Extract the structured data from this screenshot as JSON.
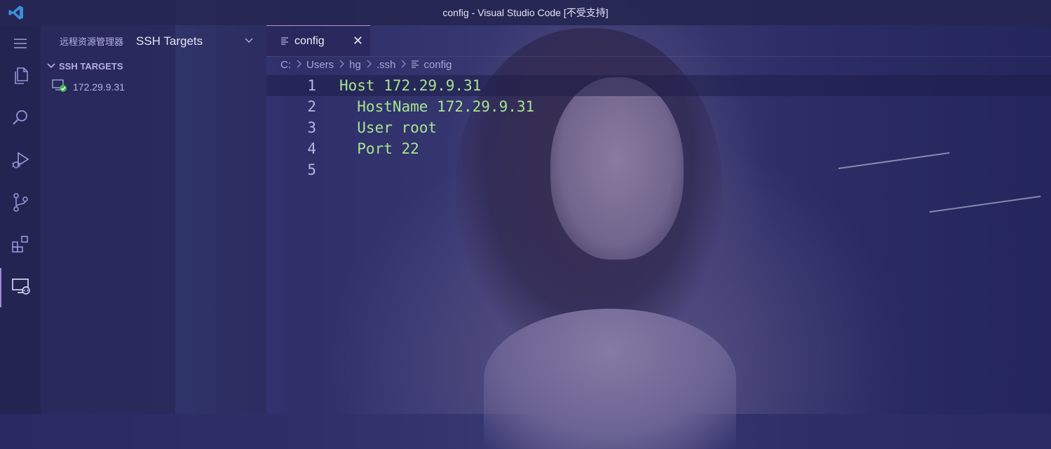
{
  "window": {
    "title": "config - Visual Studio Code [不受支持]"
  },
  "activity_bar": {
    "items": [
      {
        "icon": "menu-icon"
      },
      {
        "icon": "explorer-icon"
      },
      {
        "icon": "search-icon"
      },
      {
        "icon": "run-debug-icon"
      },
      {
        "icon": "source-control-icon"
      },
      {
        "icon": "extensions-icon"
      },
      {
        "icon": "remote-explorer-icon",
        "active": true
      }
    ]
  },
  "sidebar": {
    "view_title": "远程资源管理器",
    "targets_select": {
      "value": "SSH Targets"
    },
    "section_title": "SSH TARGETS",
    "hosts": [
      {
        "label": "172.29.9.31",
        "status": "connected"
      }
    ]
  },
  "editor": {
    "tab": {
      "label": "config",
      "close": "✕"
    },
    "breadcrumb": [
      "C:",
      "Users",
      "hg",
      ".ssh",
      "config"
    ],
    "lines": [
      {
        "number": "1",
        "text": "Host 172.29.9.31"
      },
      {
        "number": "2",
        "text": "  HostName 172.29.9.31"
      },
      {
        "number": "3",
        "text": "  User root"
      },
      {
        "number": "4",
        "text": "  Port 22"
      },
      {
        "number": "5",
        "text": ""
      }
    ]
  },
  "colors": {
    "accent": "#9d8bdb",
    "code_text": "#a6e58e",
    "status_ok": "#3fb950"
  }
}
